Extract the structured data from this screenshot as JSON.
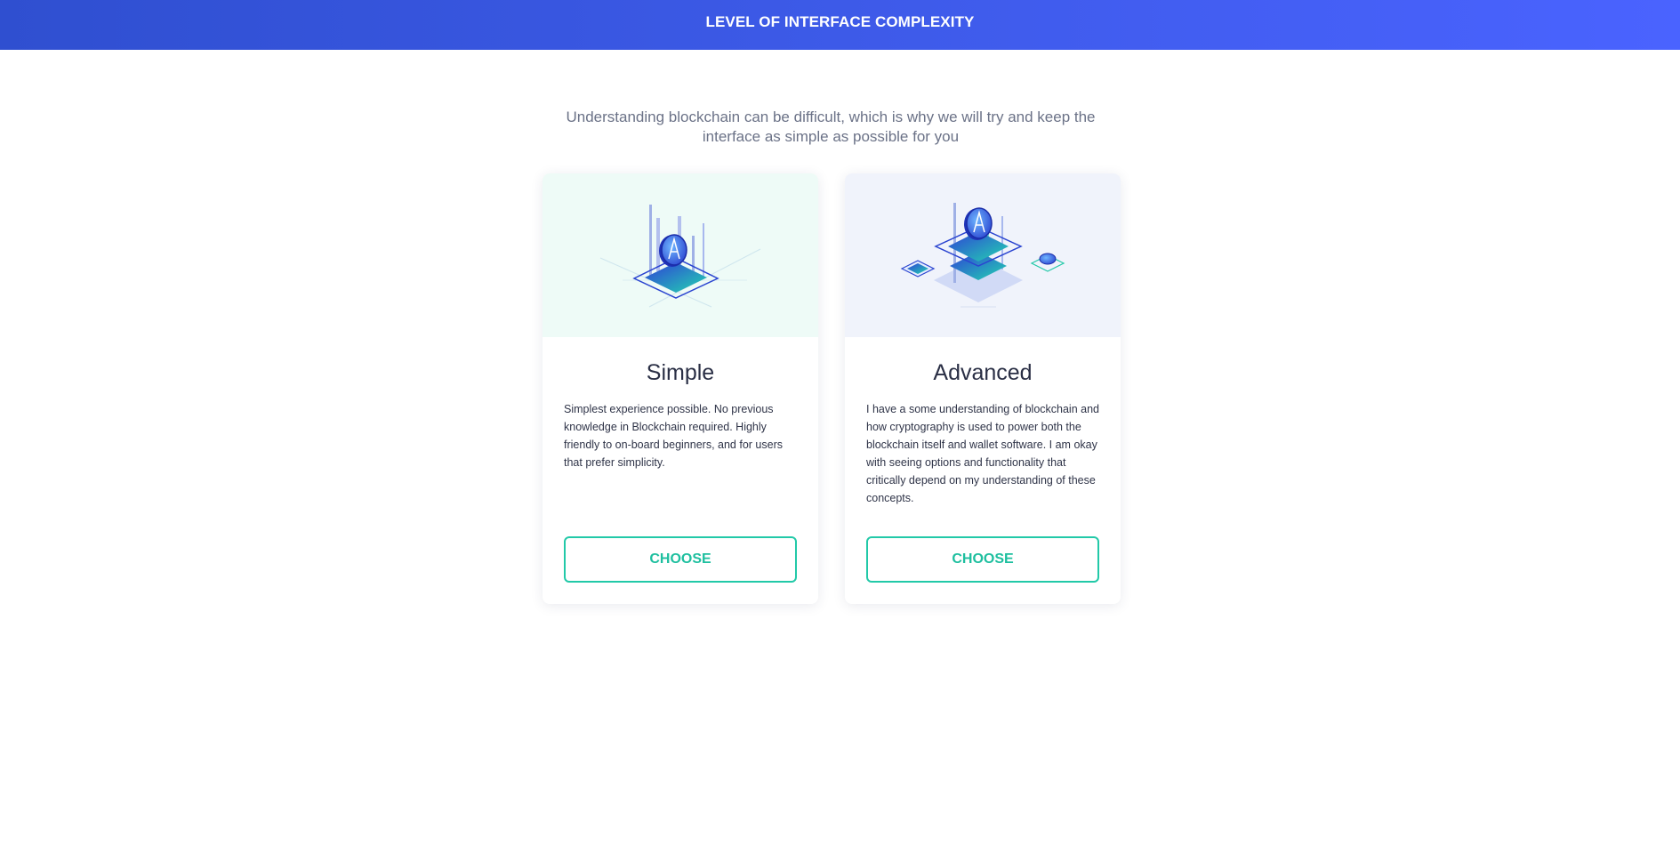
{
  "header": {
    "title": "LEVEL OF INTERFACE COMPLEXITY"
  },
  "intro": "Understanding blockchain can be difficult, which is why we will try and keep the interface as simple as possible for you",
  "cards": [
    {
      "title": "Simple",
      "description": "Simplest experience possible. No previous knowledge in Blockchain required. Highly friendly to on-board beginners, and for users that prefer simplicity.",
      "button_label": "CHOOSE",
      "illustration": "single-blockchain-node-illustration"
    },
    {
      "title": "Advanced",
      "description": "I have a some understanding of blockchain and how cryptography is used to power both the blockchain itself and wallet software. I am okay with seeing options and functionality that critically depend on my understanding of these concepts.",
      "button_label": "CHOOSE",
      "illustration": "multi-blockchain-node-illustration"
    }
  ],
  "colors": {
    "header_gradient_start": "#2f4fd0",
    "header_gradient_end": "#4a63ff",
    "accent": "#22c9a8",
    "simple_art_bg": "#eefbf7",
    "advanced_art_bg": "#f0f3fb"
  }
}
